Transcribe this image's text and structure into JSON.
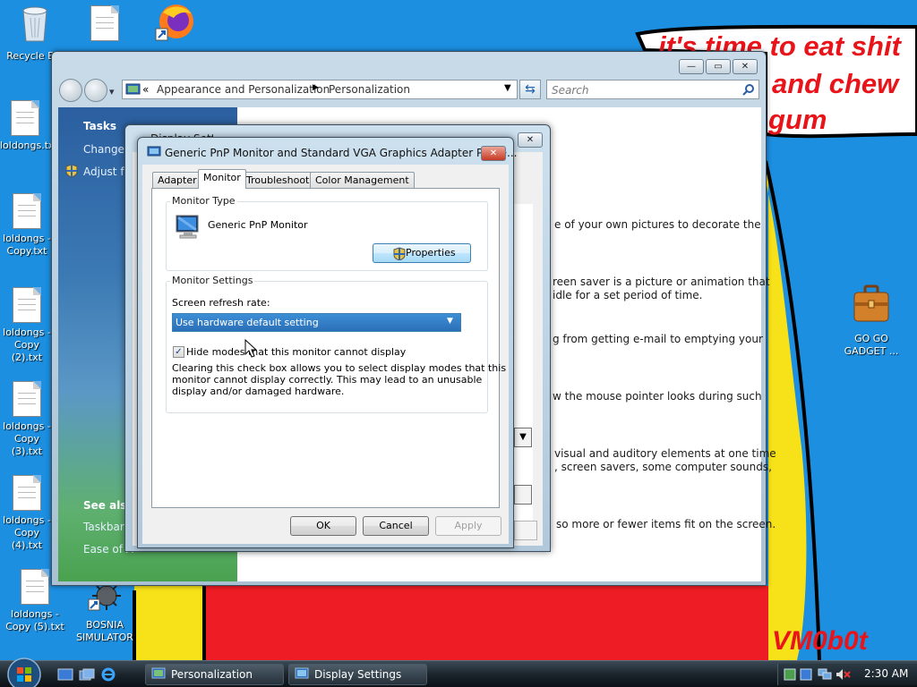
{
  "desktop": {
    "wall_text_lines": [
      "it's time to eat shit",
      "and chew",
      "gum"
    ],
    "watermark": "VM0b0t",
    "icons": [
      {
        "label": "Recycle Bin"
      },
      {
        "label": ""
      },
      {
        "label": ""
      },
      {
        "label": "loldongs.txt"
      },
      {
        "label": "loldongs - Copy.txt"
      },
      {
        "label": "loldongs - Copy (2).txt"
      },
      {
        "label": "loldongs - Copy (3).txt"
      },
      {
        "label": "loldongs - Copy (4).txt"
      },
      {
        "label": "loldongs - Copy (5).txt"
      },
      {
        "label": "BOSNIA SIMULATOR"
      },
      {
        "label": "GO GO GADGET ..."
      }
    ]
  },
  "explorer": {
    "breadcrumb": {
      "overflow": "«",
      "parts": [
        "Appearance and Personalization",
        "Personalization"
      ]
    },
    "search_placeholder": "Search",
    "tasks": {
      "heading": "Tasks",
      "links": [
        "Change d",
        "Adjust fo"
      ]
    },
    "see_also": {
      "heading": "See also",
      "links": [
        "Taskbar a",
        "Ease of A"
      ]
    },
    "descriptions": [
      "e of your own pictures to decorate the",
      "reen saver is a picture or animation that",
      "idle for a set period of time.",
      "g from getting e-mail to emptying your",
      "w the mouse pointer looks during such",
      "visual and auditory elements at one time",
      ", screen savers, some computer sounds,",
      "so more or fewer items fit on the screen."
    ]
  },
  "display_settings": {
    "title": "Display Settings"
  },
  "props": {
    "title": "Generic PnP Monitor and Standard VGA Graphics Adapter Prope...",
    "tabs": [
      "Adapter",
      "Monitor",
      "Troubleshoot",
      "Color Management"
    ],
    "active_tab": "Monitor",
    "monitor_type": {
      "group_title": "Monitor Type",
      "monitor_name": "Generic PnP Monitor",
      "properties_button": "Properties"
    },
    "monitor_settings": {
      "group_title": "Monitor Settings",
      "refresh_label": "Screen refresh rate:",
      "refresh_value": "Use hardware default setting",
      "hide_modes_label": "Hide modes that this monitor cannot display",
      "hide_modes_checked": true,
      "explanation": [
        "Clearing this check box allows you to select display modes that this",
        "monitor cannot display correctly. This may lead to an unusable",
        "display and/or damaged hardware."
      ]
    },
    "buttons": {
      "ok": "OK",
      "cancel": "Cancel",
      "apply": "Apply"
    }
  },
  "taskbar": {
    "buttons": [
      {
        "label": "Personalization"
      },
      {
        "label": "Display Settings"
      }
    ],
    "clock": "2:30 AM"
  },
  "colors": {
    "desktop_blue": "#1c8fe0",
    "wall_red": "#e8141a",
    "window_frame": "#c9dbe8"
  }
}
